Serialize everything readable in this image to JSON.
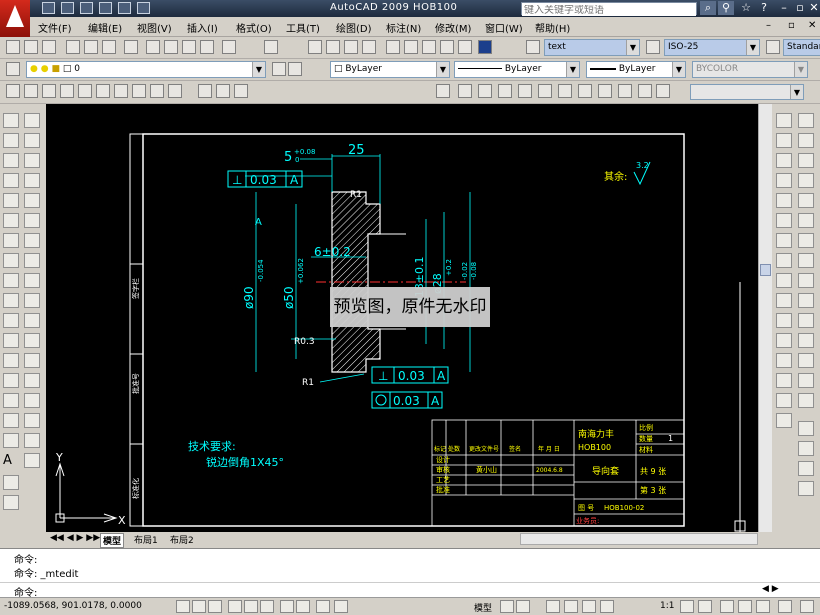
{
  "app": {
    "title": "AutoCAD 2009 HOB100",
    "search_placeholder": "键入关键字或短语"
  },
  "menu": [
    "文件(F)",
    "编辑(E)",
    "视图(V)",
    "插入(I)",
    "格式(O)",
    "工具(T)",
    "绘图(D)",
    "标注(N)",
    "修改(M)",
    "窗口(W)",
    "帮助(H)"
  ],
  "toolbar": {
    "text_style": "text",
    "dim_style": "ISO-25",
    "table_style": "Standar",
    "layer": "0",
    "color": "ByLayer",
    "linetype": "ByLayer",
    "lineweight": "ByLayer",
    "plotstyle": "BYCOLOR"
  },
  "drawing": {
    "tech_req_title": "技术要求:",
    "tech_req_body": "锐边倒角1X45°",
    "surface_rest": "其余:",
    "roughness_top": "3.2",
    "dim_25": "25",
    "dim_5": "5",
    "dim_5_tol": "+0.08",
    "dim_5_tol2": "0",
    "dim_6": "6±0.2",
    "r1_top": "R1",
    "r1_bottom": "R1",
    "r03": "R0.3",
    "dim_phi90": "ø90",
    "dim_phi90_tol": "-0.054",
    "dim_phi50": "ø50",
    "dim_phi50_tol": "+0.062",
    "dim_phi18": "ø18±0.1",
    "dim_phi28": "ø28",
    "dim_phi28_tol": "+0.2",
    "dim_phi100": "-0.08",
    "dim_phi100_b": "-0.02",
    "fcf_top_val": "0.03",
    "fcf_top_datum": "A",
    "fcf_mid_val": "0.03",
    "fcf_mid_datum": "A",
    "fcf_bot_val": "0.03",
    "fcf_bot_datum": "A",
    "datum_label": "A",
    "tb_company": "南海力丰",
    "tb_model": "HOB100",
    "tb_part": "导向套",
    "tb_drawing_no": "HOB100-02",
    "tb_scale_label": "比例",
    "tb_count_label": "数量",
    "tb_material_label": "材料",
    "tb_scale": "1",
    "tb_total_sheets": "共 9 张",
    "tb_sheet": "第 3 张",
    "tb_designer": "黄小山",
    "tb_date": "2004.6.8",
    "tb_rows": [
      "设计",
      "审核",
      "工艺",
      "批准"
    ],
    "tb_header": [
      "标记",
      "处数",
      "更改文件号",
      "签名",
      "年 月 日"
    ],
    "tb_drawing_label": "图 号",
    "tb_customer_label": "业务员:",
    "border_labels": [
      "签字栏",
      "批准号",
      "标准化"
    ],
    "axis_y": "Y",
    "axis_x": "X"
  },
  "layout_tabs": [
    "模型",
    "布局1",
    "布局2"
  ],
  "command": {
    "line1": "命令:",
    "line2": "命令: _mtedit",
    "prompt": "命令:"
  },
  "status": {
    "coords": "-1089.0568, 901.0178, 0.0000",
    "model_label": "模型",
    "scale": "1:1"
  },
  "watermark": "预览图，原件无水印"
}
